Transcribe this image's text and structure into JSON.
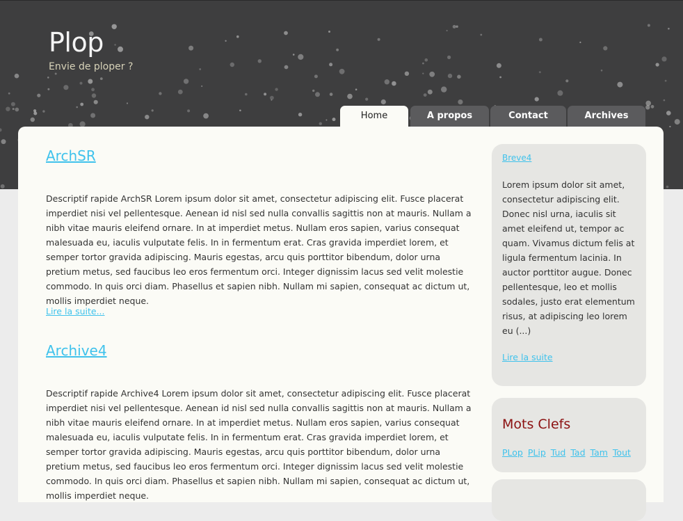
{
  "site": {
    "title": "Plop",
    "tagline": "Envie de ploper ?"
  },
  "nav": {
    "tabs": [
      {
        "label": "Home",
        "active": true
      },
      {
        "label": "A propos",
        "active": false
      },
      {
        "label": "Contact",
        "active": false
      },
      {
        "label": "Archives",
        "active": false
      }
    ]
  },
  "articles": [
    {
      "title": "ArchSR",
      "description": "Descriptif rapide ArchSR Lorem ipsum dolor sit amet, consectetur adipiscing elit. Fusce placerat imperdiet nisi vel pellentesque. Aenean id nisl sed nulla convallis sagittis non at mauris. Nullam a nibh vitae mauris eleifend ornare. In at imperdiet metus. Nullam eros sapien, varius consequat malesuada eu, iaculis vulputate felis. In in fermentum erat. Cras gravida imperdiet lorem, et semper tortor gravida adipiscing. Mauris egestas, arcu quis porttitor bibendum, dolor urna pretium metus, sed faucibus leo eros fermentum orci. Integer dignissim lacus sed velit molestie commodo. In quis orci diam. Phasellus et sapien nibh. Nullam mi sapien, consequat ac dictum ut, mollis imperdiet neque.",
      "read_more": "Lire la suite..."
    },
    {
      "title": "Archive4",
      "description": "Descriptif rapide Archive4 Lorem ipsum dolor sit amet, consectetur adipiscing elit. Fusce placerat imperdiet nisi vel pellentesque. Aenean id nisl sed nulla convallis sagittis non at mauris. Nullam a nibh vitae mauris eleifend ornare. In at imperdiet metus. Nullam eros sapien, varius consequat malesuada eu, iaculis vulputate felis. In in fermentum erat. Cras gravida imperdiet lorem, et semper tortor gravida adipiscing. Mauris egestas, arcu quis porttitor bibendum, dolor urna pretium metus, sed faucibus leo eros fermentum orci. Integer dignissim lacus sed velit molestie commodo. In quis orci diam. Phasellus et sapien nibh. Nullam mi sapien, consequat ac dictum ut, mollis imperdiet neque."
    }
  ],
  "sidebar": {
    "brief": {
      "title": "Breve4",
      "text": "Lorem ipsum dolor sit amet, consectetur adipiscing elit. Donec nisl urna, iaculis sit amet eleifend ut, tempor ac quam. Vivamus dictum felis at ligula fermentum lacinia. In auctor porttitor augue. Donec pellentesque, leo et mollis sodales, justo erat elementum risus, at adipiscing leo lorem eu (...)",
      "read_more": "Lire la suite"
    },
    "keywords": {
      "title": "Mots Clefs",
      "tags": [
        "PLop",
        "PLip",
        "Tud",
        "Tad",
        "Tam",
        "Tout"
      ]
    }
  },
  "colors": {
    "header_bg": "#3e3e3f",
    "page_bg": "#fbfbf6",
    "link": "#3fc2ec",
    "keywords_title": "#8b1010",
    "tab_bg": "#5b5b5d",
    "sidebar_box": "#e6e6e3"
  }
}
